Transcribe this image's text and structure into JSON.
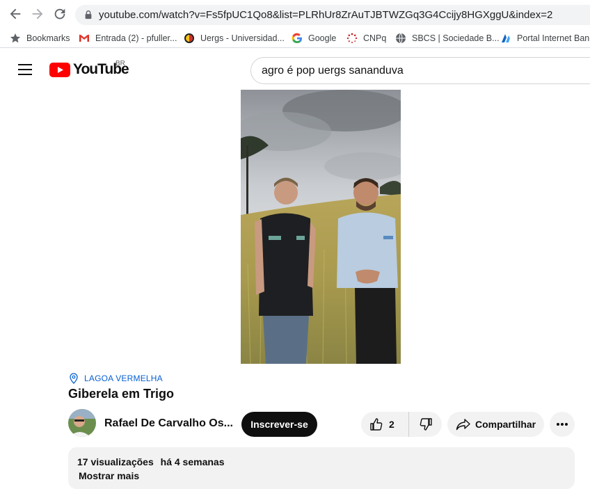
{
  "browser": {
    "url": "youtube.com/watch?v=Fs5fpUC1Qo8&list=PLRhUr8ZrAuTJBTWZGq3G4Ccijy8HGXggU&index=2",
    "bookmarks": [
      {
        "label": "Bookmarks",
        "icon": "star-icon"
      },
      {
        "label": "Entrada (2) - pfuller...",
        "icon": "gmail-icon"
      },
      {
        "label": "Uergs - Universidad...",
        "icon": "uergs-icon"
      },
      {
        "label": "Google",
        "icon": "google-icon"
      },
      {
        "label": "CNPq",
        "icon": "cnpq-icon"
      },
      {
        "label": "SBCS | Sociedade B...",
        "icon": "globe-icon"
      },
      {
        "label": "Portal Internet Banr...",
        "icon": "banrisul-icon"
      }
    ]
  },
  "header": {
    "logo_text": "YouTube",
    "region": "BR",
    "search_value": "agro é pop uergs sananduva"
  },
  "video": {
    "location": "LAGOA VERMELHA",
    "title": "Giberela em Trigo",
    "channel": "Rafael De Carvalho Os...",
    "subscribe_label": "Inscrever-se",
    "like_count": "2",
    "share_label": "Compartilhar",
    "views": "17 visualizações",
    "date": "há 4 semanas",
    "show_more": "Mostrar mais"
  },
  "colors": {
    "youtube_red": "#ff0000",
    "link_blue": "#065fd4",
    "pill_bg": "#f2f2f2"
  }
}
